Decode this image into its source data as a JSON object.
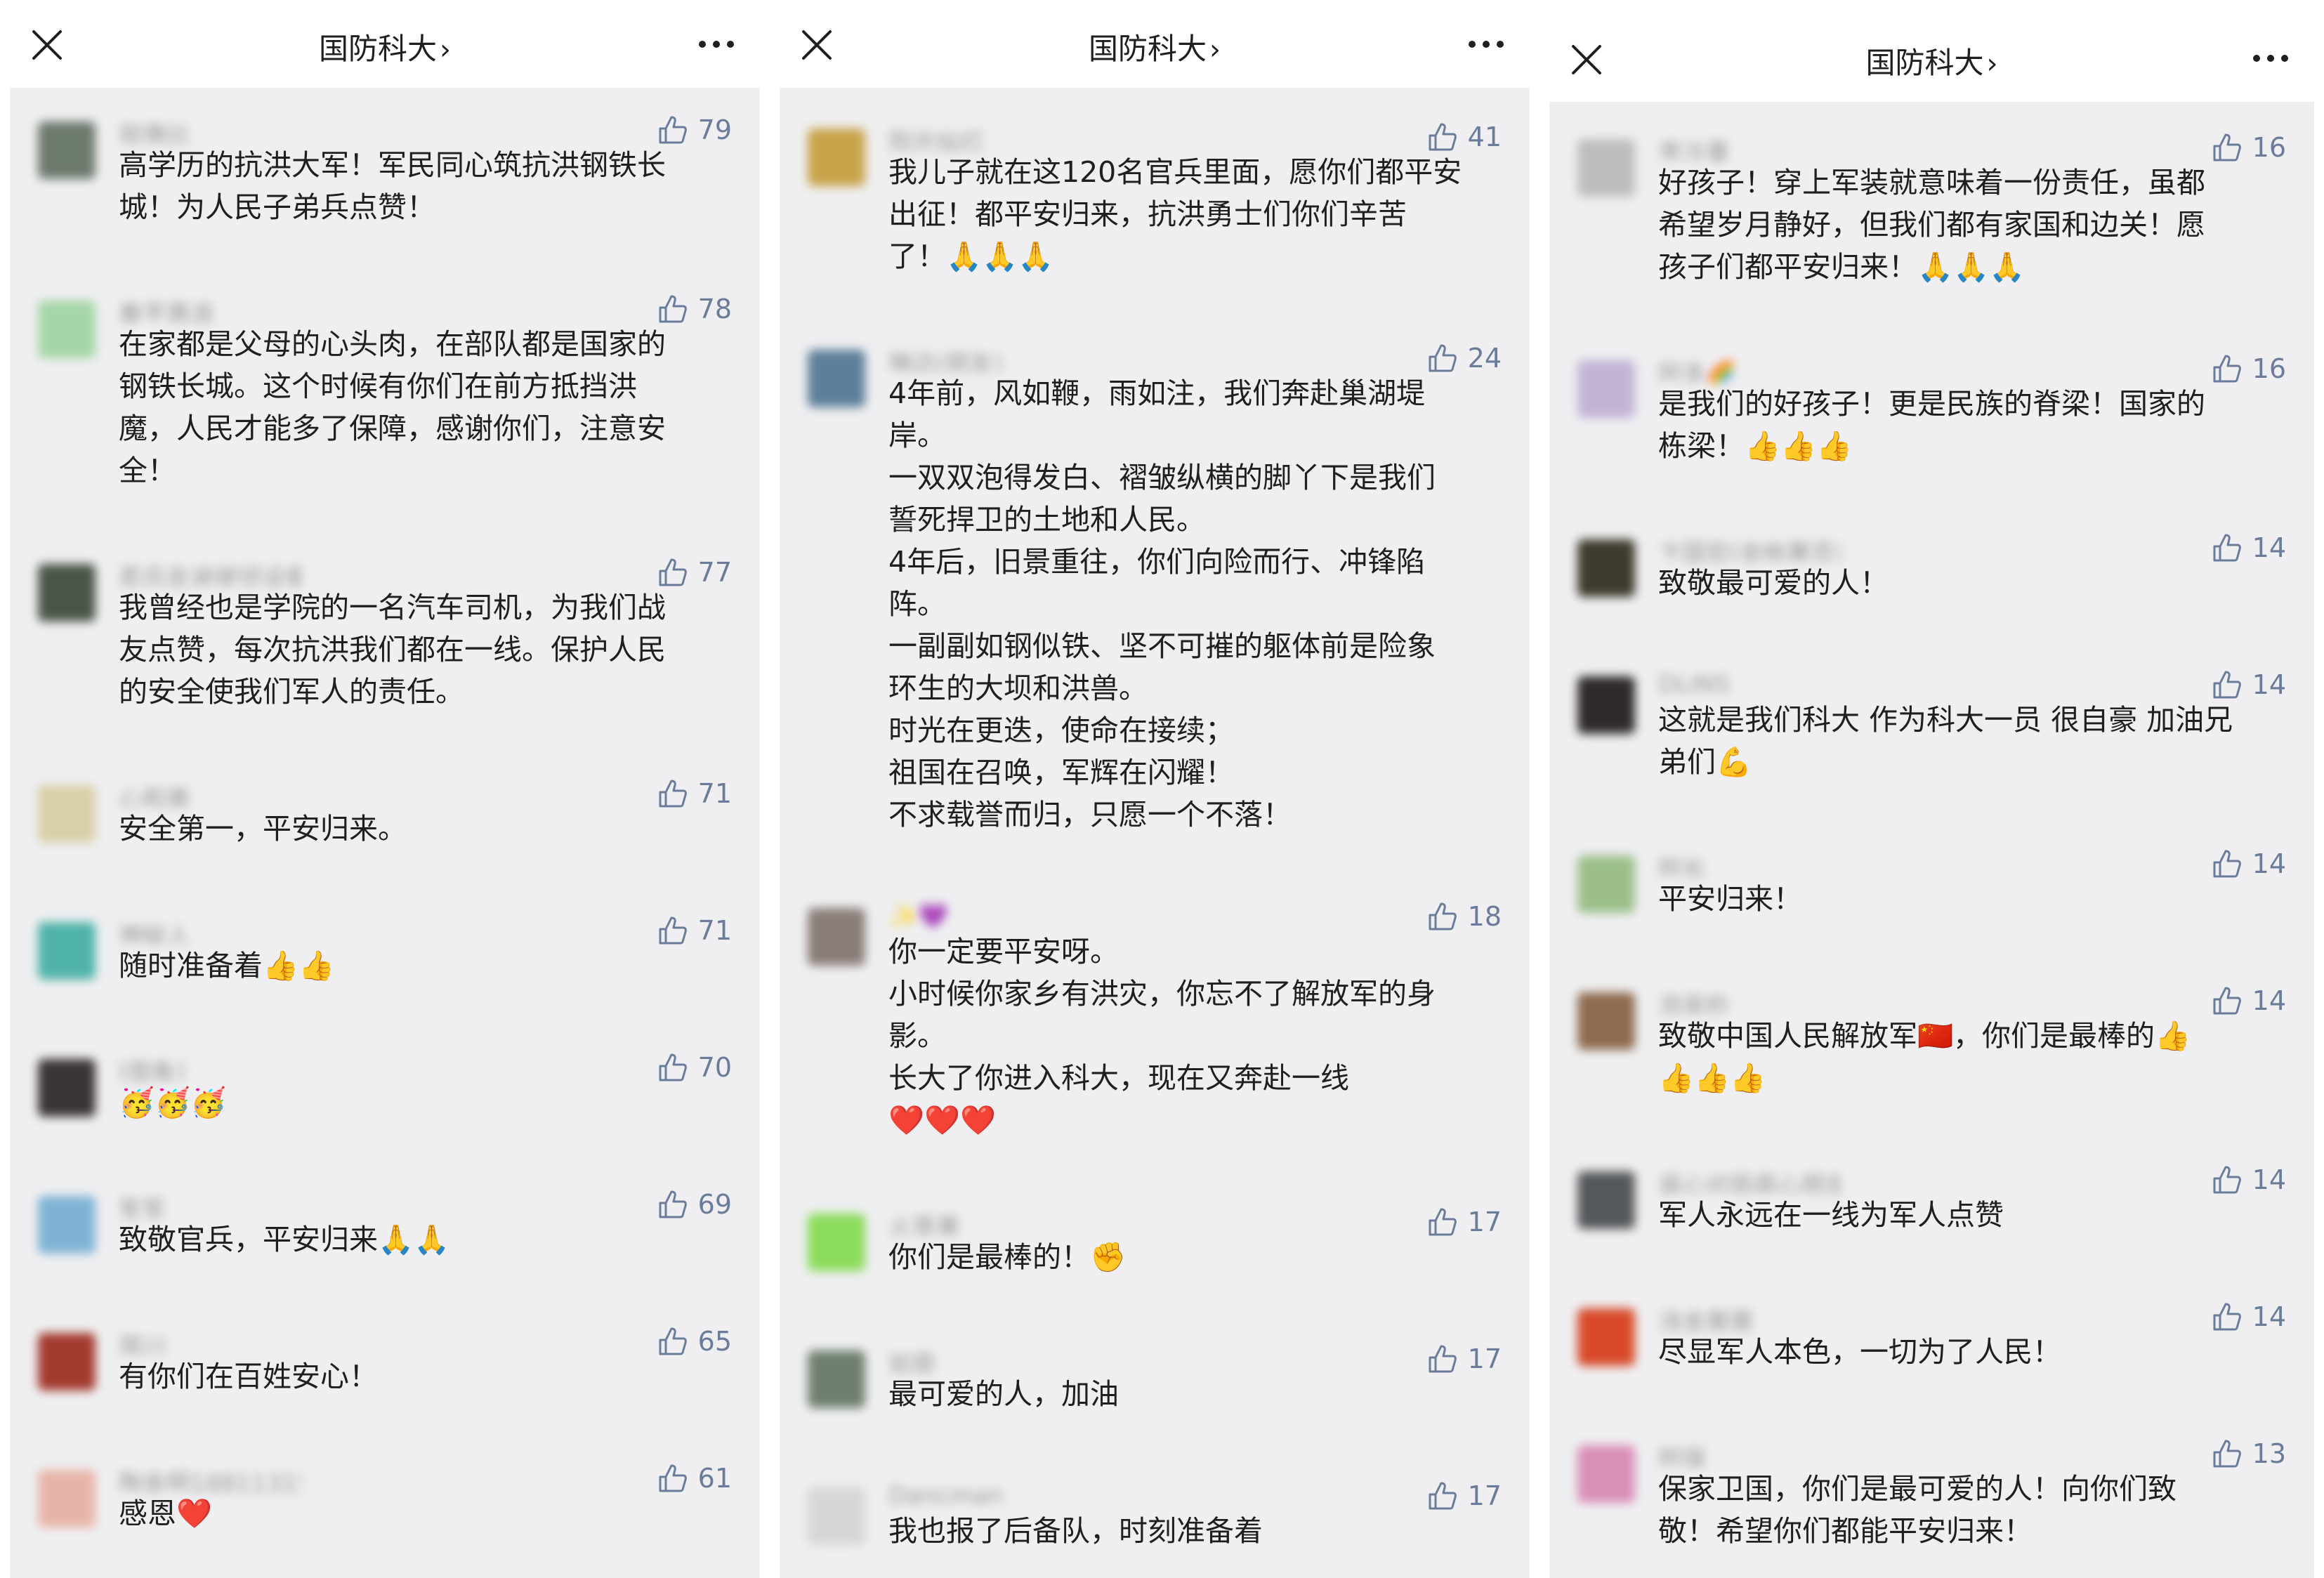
{
  "panels": [
    {
      "header": {
        "title": "国防科大",
        "chevron": "›",
        "close_icon": "close-icon",
        "more_icon": "more-icon"
      },
      "comments": [
        {
          "user": "就佛比",
          "likes": "79",
          "text": "高学历的抗洪大军！军民同心筑抗洪钢铁长\n城！为人民子弟兵点赞！",
          "avatar_color": "#6d7a6e"
        },
        {
          "user": "春芊惠浪",
          "likes": "78",
          "text": "在家都是父母的心头肉，在部队都是国家的\n钢铁长城。这个时候有你们在前方抵挡洪\n魔，人民才能多了保障，感谢你们，注意安\n全！",
          "avatar_color": "#a5d6a7"
        },
        {
          "user": "若兵友迪驶径设备",
          "likes": "77",
          "text": "我曾经也是学院的一名汽车司机，为我们战\n友点赞，每次抗洪我们都在一线。保护人民\n的安全使我们军人的责任。",
          "avatar_color": "#4a5448"
        },
        {
          "user": "心和美",
          "likes": "71",
          "text": "安全第一，平安归来。",
          "avatar_color": "#d9cfa8"
        },
        {
          "user": "神秘人",
          "likes": "71",
          "text": "随时准备着👍👍",
          "avatar_color": "#4fb3a9"
        },
        {
          "user": "[图象]",
          "likes": "70",
          "text": "🥳🥳🥳",
          "avatar_color": "#3b3434"
        },
        {
          "user": "笙笙",
          "likes": "69",
          "text": "致敬官兵，平安归来🙏🙏",
          "avatar_color": "#7fb3d5"
        },
        {
          "user": "简川",
          "likes": "65",
          "text": "有你们在百姓安心！",
          "avatar_color": "#a33a2e"
        },
        {
          "user": "陶金明18811315717",
          "likes": "61",
          "text": "感恩❤️",
          "avatar_color": "#e8b4a8"
        }
      ]
    },
    {
      "header": {
        "title": "国防科大",
        "chevron": "›",
        "close_icon": "close-icon",
        "more_icon": "more-icon"
      },
      "comments": [
        {
          "user": "阳光灿烂",
          "likes": "41",
          "text": "我儿子就在这120名官兵里面，愿你们都平安\n出征！都平安归来，抗洪勇士们你们辛苦\n了！🙏🙏🙏",
          "avatar_color": "#c9a34a"
        },
        {
          "user": "琳达(朋友)",
          "likes": "24",
          "text": "4年前，风如鞭，雨如注，我们奔赴巢湖堤\n岸。\n一双双泡得发白、褶皱纵横的脚丫下是我们\n誓死捍卫的土地和人民。\n4年后，旧景重往，你们向险而行、冲锋陷\n阵。\n一副副如钢似铁、坚不可摧的躯体前是险象\n环生的大坝和洪兽。\n时光在更迭，使命在接续；\n祖国在召唤，军辉在闪耀！\n不求载誉而归，只愿一个不落！",
          "avatar_color": "#5d7f99"
        },
        {
          "user": "✨💜",
          "likes": "18",
          "text": "你一定要平安呀。\n小时候你家乡有洪灾，你忘不了解放军的身\n影。\n长大了你进入科大，现在又奔赴一线\n❤️❤️❤️",
          "avatar_color": "#8a7d78"
        },
        {
          "user": "火草果",
          "likes": "17",
          "text": "你们是最棒的！✊",
          "avatar_color": "#8bdc5c"
        },
        {
          "user": "如是",
          "likes": "17",
          "text": "最可爱的人，加油",
          "avatar_color": "#6f7f6f"
        },
        {
          "user": "Dancman",
          "likes": "17",
          "text": "我也报了后备队，时刻准备着",
          "avatar_color": "#d6d6d6"
        }
      ]
    },
    {
      "header": {
        "title": "国防科大",
        "chevron": "›",
        "close_icon": "close-icon",
        "more_icon": "more-icon"
      },
      "comments": [
        {
          "user": "李冷蔓",
          "likes": "16",
          "text": "好孩子！穿上军装就意味着一份责任，虽都\n希望岁月静好，但我们都有家国和边关！愿\n孩子们都平安归来！🙏🙏🙏",
          "avatar_color": "#bdbdbd"
        },
        {
          "user": "阿多🌈",
          "likes": "16",
          "text": "是我们的好孩子！更是民族的脊梁！国家的\n栋梁！👍👍👍",
          "avatar_color": "#c2b3d6"
        },
        {
          "user": "卞国宏(金帐寨员)",
          "likes": "14",
          "text": "致敬最可爱的人！",
          "avatar_color": "#3e3a2c"
        },
        {
          "user": "DLINS",
          "likes": "14",
          "text": "这就是我们科大 作为科大一员 很自豪 加油兄\n弟们💪",
          "avatar_color": "#2f2a2a"
        },
        {
          "user": "阿长",
          "likes": "14",
          "text": "平安归来！",
          "avatar_color": "#9cbf8a"
        },
        {
          "user": "流泉秒",
          "likes": "14",
          "text": "致敬中国人民解放军🇨🇳，你们是最棒的👍\n👍👍👍",
          "avatar_color": "#8d6b4f"
        },
        {
          "user": "遥心对局高心朋友",
          "likes": "14",
          "text": "军人永远在一线为军人点赞",
          "avatar_color": "#55585a"
        },
        {
          "user": "浅金蓑蓑",
          "likes": "14",
          "text": "尽显军人本色，一切为了人民！",
          "avatar_color": "#d84a2a"
        },
        {
          "user": "阿保",
          "likes": "13",
          "text": "保家卫国，你们是最可爱的人！向你们致\n敬！希望你们都能平安归来！",
          "avatar_color": "#d98fb8"
        }
      ]
    }
  ]
}
